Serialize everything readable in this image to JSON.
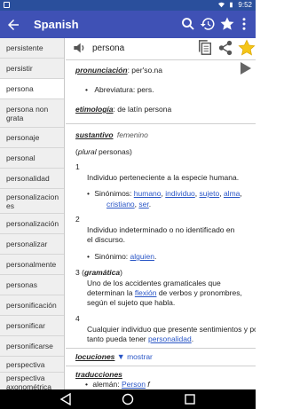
{
  "status": {
    "time": "9:52"
  },
  "app": {
    "title": "Spanish"
  },
  "sidebar": {
    "items": [
      {
        "label": "persistente"
      },
      {
        "label": "persistir"
      },
      {
        "label": "persona"
      },
      {
        "label": "persona non grata"
      },
      {
        "label": "personaje"
      },
      {
        "label": "personal"
      },
      {
        "label": "personalidad"
      },
      {
        "label": "personalizaciones"
      },
      {
        "label": "personalización"
      },
      {
        "label": "personalizar"
      },
      {
        "label": "personalmente"
      },
      {
        "label": "personas"
      },
      {
        "label": "personificación"
      },
      {
        "label": "personificar"
      },
      {
        "label": "personificarse"
      },
      {
        "label": "perspectiva"
      },
      {
        "label": "perspectiva axonométrica"
      }
    ],
    "selected": "persona"
  },
  "entry": {
    "word": "persona",
    "pron_label": "pronunciación",
    "pron_value": ": per'so.na",
    "abbr_label": "Abreviatura",
    "abbr_value": ": pers.",
    "etym_label": "etimología",
    "etym_value": ": de latín persona",
    "pos": "sustantivo",
    "gender": "femenino",
    "plural_prefix": "(",
    "plural_label": "plural",
    "plural_value": " personas)",
    "senses": [
      {
        "num": "1",
        "text": "Individuo perteneciente a la especie humana.",
        "syn_label": "Sinónimos",
        "syns": [
          "humano",
          "individuo",
          "sujeto",
          "alma",
          "cristiano",
          "ser"
        ]
      },
      {
        "num": "2",
        "text_l1": "Individuo indeterminado o no identificado en",
        "text_l2": "el discurso.",
        "syn_label": "Sinónimo",
        "syns": [
          "alguien"
        ]
      },
      {
        "num": "3",
        "area": "gramática",
        "text_l1": "Uno de los accidentes gramaticales que",
        "text_l2a": "determinan la ",
        "text_l2_link": "flexión",
        "text_l2b": " de verbos y pronombres,",
        "text_l3": "según el sujeto que habla."
      },
      {
        "num": "4",
        "text_l1": "Cualquier individuo que presente sentimientos y por",
        "text_l2a": "tanto pueda tener ",
        "text_l2_link": "personalidad",
        "text_l2b": "."
      }
    ],
    "locuciones_label": "locuciones",
    "show_label": "mostrar",
    "traducciones_label": "traducciones",
    "trans_lang": "alemán",
    "trans_word": "Person",
    "trans_gender": "f"
  }
}
